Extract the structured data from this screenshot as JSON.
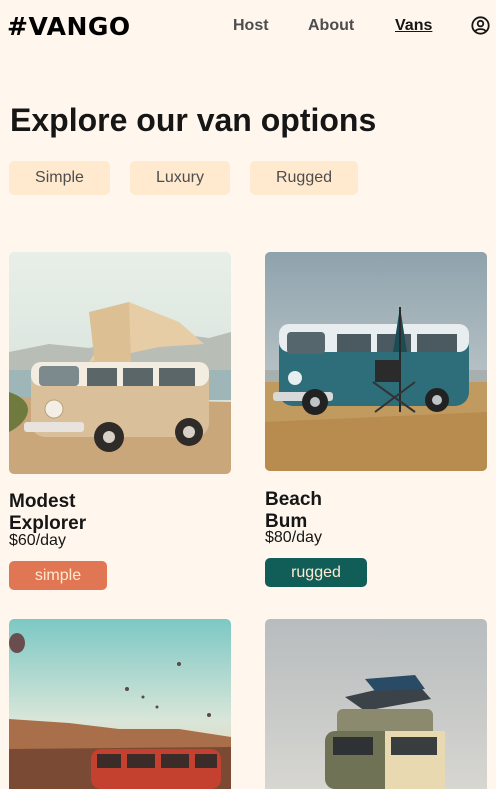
{
  "header": {
    "logo": "#VANGO",
    "nav": [
      {
        "label": "Host"
      },
      {
        "label": "About"
      },
      {
        "label": "Vans"
      }
    ],
    "account_icon": "user-circle-icon"
  },
  "page_title": "Explore our van options",
  "filters": [
    "Simple",
    "Luxury",
    "Rugged"
  ],
  "vans": [
    {
      "name": "Modest Explorer",
      "price": "$60",
      "unit": "/day",
      "type": "simple",
      "badge_color": "#e17654"
    },
    {
      "name": "Beach Bum",
      "price": "$80",
      "unit": "/day",
      "type": "rugged",
      "badge_color": "#115e59"
    },
    {
      "name": "",
      "price": "",
      "unit": "",
      "type": ""
    },
    {
      "name": "",
      "price": "",
      "unit": "",
      "type": ""
    }
  ],
  "colors": {
    "background": "#fff7ed",
    "filter_bg": "#ffead0",
    "simple": "#e17654",
    "rugged": "#115e59"
  }
}
